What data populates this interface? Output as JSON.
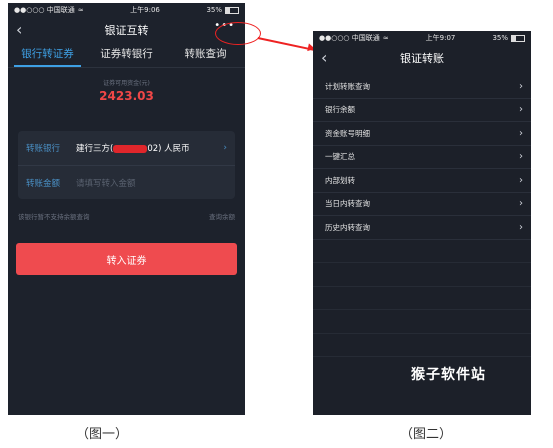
{
  "phone1": {
    "status": {
      "carrier": "●●○○○ 中国联通",
      "wifi": "≈",
      "time": "上午9:06",
      "battery_pct": "35%"
    },
    "nav": {
      "title": "银证互转",
      "back_icon": "‹",
      "more_icon": "•••"
    },
    "tabs": [
      "银行转证券",
      "证券转银行",
      "转账查询"
    ],
    "balance_label": "证券可用资金(元)",
    "balance_value": "2423.03",
    "form": {
      "bank_label": "转账银行",
      "bank_value_prefix": "建行三方(",
      "bank_value_suffix": "02) 人民币",
      "amount_label": "转账金额",
      "amount_placeholder": "请填写转入金额"
    },
    "hint_left": "该银行暂不支持余额查询",
    "hint_right": "查询余额",
    "submit_label": "转入证券"
  },
  "phone2": {
    "status": {
      "carrier": "●●○○○ 中国联通",
      "wifi": "≈",
      "time": "上午9:07",
      "battery_pct": "35%"
    },
    "nav": {
      "title": "银证转账",
      "back_icon": "‹"
    },
    "menu": [
      "计划转账查询",
      "银行余额",
      "资金账号明细",
      "一键汇总",
      "内部划转",
      "当日内转查询",
      "历史内转查询"
    ]
  },
  "watermark": "猴子软件站",
  "captions": [
    "（图一）",
    "（图二）"
  ],
  "colors": {
    "accent": "#3ea0e4",
    "danger": "#ef4b4f",
    "background": "#1d222c"
  }
}
